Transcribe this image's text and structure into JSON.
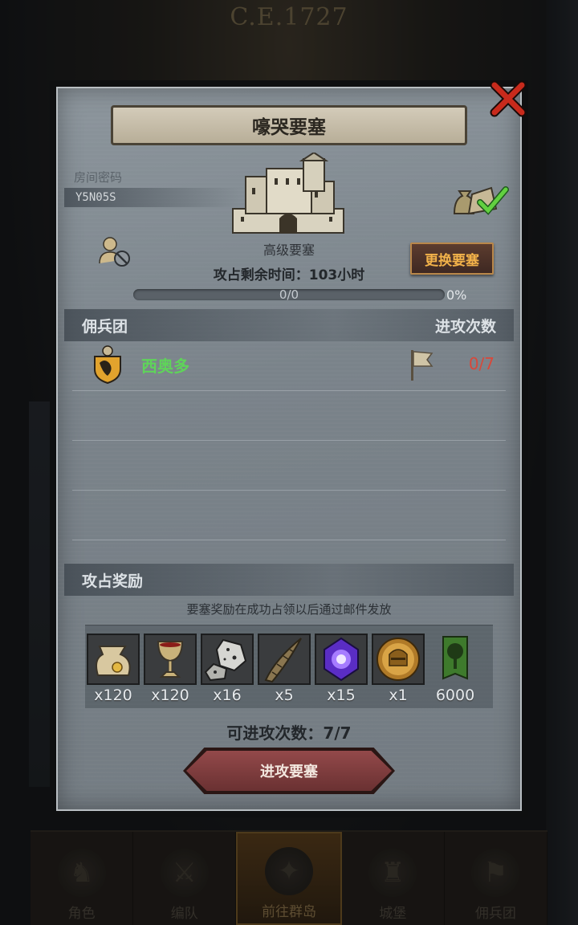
{
  "background": {
    "era": "C.E.1727",
    "nav_tabs": [
      {
        "label": "角色",
        "icon": "knight-icon"
      },
      {
        "label": "编队",
        "icon": "formation-icon"
      },
      {
        "label": "前往群岛",
        "icon": "compass-icon",
        "active": true
      },
      {
        "label": "城堡",
        "icon": "castle-icon"
      },
      {
        "label": "佣兵团",
        "icon": "mercenary-icon"
      }
    ]
  },
  "dialog": {
    "title": "嚎哭要塞",
    "room_label": "房间密码",
    "room_code": "Y5N05S",
    "fortress_grade": "高级要塞",
    "change_button": "更换要塞",
    "time_remaining": "攻占剩余时间：103小时",
    "progress": {
      "text": "0/0",
      "percent": "0%",
      "fill_fraction": 0
    },
    "mercenary_header": "佣兵团",
    "attack_count_header": "进攻次数",
    "mercenaries": [
      {
        "name": "西奥多",
        "attacks": "0/7"
      }
    ],
    "reward_header": "攻占奖励",
    "reward_note": "要塞奖励在成功占领以后通过邮件发放",
    "rewards": [
      {
        "icon": "coin-sack-icon",
        "qty": "x120"
      },
      {
        "icon": "goblet-icon",
        "qty": "x120"
      },
      {
        "icon": "ore-stone-icon",
        "qty": "x16"
      },
      {
        "icon": "horn-icon",
        "qty": "x5"
      },
      {
        "icon": "purple-gem-icon",
        "qty": "x15"
      },
      {
        "icon": "helmet-medal-icon",
        "qty": "x1"
      },
      {
        "icon": "tree-banner-icon",
        "qty": "6000"
      }
    ],
    "attacks_available": "可进攻次数：7/7",
    "attack_button": "进攻要塞"
  },
  "colors": {
    "merc_name": "#5fd35a",
    "attack_count_red": "#d8483a",
    "change_button_text": "#f2b24a",
    "close_red": "#c82a1c"
  }
}
